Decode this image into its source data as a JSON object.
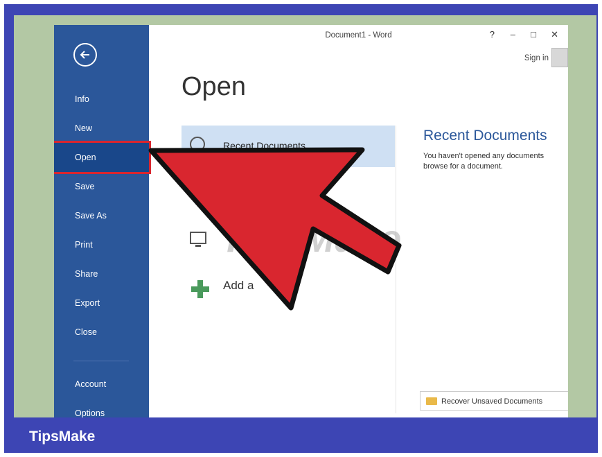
{
  "window": {
    "title": "Document1 - Word",
    "help": "?",
    "minimize": "–",
    "maximize": "□",
    "close": "✕",
    "sign_in": "Sign in"
  },
  "sidebar": {
    "items": [
      {
        "label": "Info"
      },
      {
        "label": "New"
      },
      {
        "label": "Open",
        "active": true
      },
      {
        "label": "Save"
      },
      {
        "label": "Save As"
      },
      {
        "label": "Print"
      },
      {
        "label": "Share"
      },
      {
        "label": "Export"
      },
      {
        "label": "Close"
      },
      {
        "label": "Account"
      },
      {
        "label": "Options"
      }
    ]
  },
  "main": {
    "heading": "Open",
    "locations": [
      {
        "label": "Recent Documents",
        "icon": "clock-icon"
      },
      {
        "label": "Add a Place",
        "visible_text": "Add a",
        "icon": "plus-icon"
      }
    ],
    "computer_icon": "computer-icon"
  },
  "recent": {
    "title": "Recent Documents",
    "line1": "You haven't opened any documents",
    "line2": "browse for a document.",
    "recover_label": "Recover Unsaved Documents"
  },
  "overlay": {
    "watermark": "TipsMake",
    "arrow_color": "#d9262f"
  },
  "footer": {
    "brand": "TipsMake"
  },
  "colors": {
    "frame": "#3d45b4",
    "sidebar": "#2b579a",
    "highlight": "#cfe0f3",
    "accent_red": "#d9262f"
  }
}
